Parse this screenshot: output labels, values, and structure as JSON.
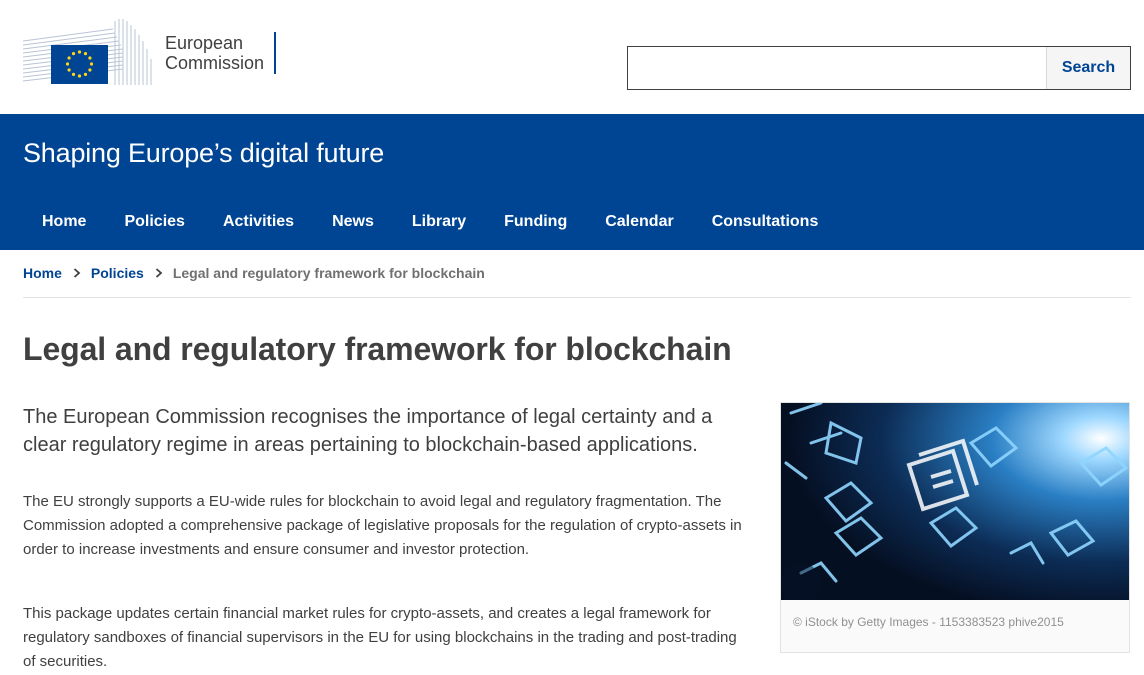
{
  "header": {
    "logo_line1": "European",
    "logo_line2": "Commission",
    "search_placeholder": "",
    "search_label": "Search"
  },
  "site": {
    "name": "Shaping Europe’s digital future"
  },
  "nav": {
    "items": [
      {
        "label": "Home"
      },
      {
        "label": "Policies"
      },
      {
        "label": "Activities"
      },
      {
        "label": "News"
      },
      {
        "label": "Library"
      },
      {
        "label": "Funding"
      },
      {
        "label": "Calendar"
      },
      {
        "label": "Consultations"
      }
    ]
  },
  "breadcrumb": {
    "items": [
      {
        "label": "Home"
      },
      {
        "label": "Policies"
      }
    ],
    "current": "Legal and regulatory framework for blockchain"
  },
  "page": {
    "title": "Legal and regulatory framework for blockchain",
    "lead": "The European Commission recognises the importance of legal certainty and a clear regulatory regime in areas pertaining to blockchain-based applications.",
    "paragraphs": [
      "The EU strongly supports a EU-wide rules for blockchain to avoid legal and regulatory fragmentation. The Commission adopted a comprehensive package of legislative proposals for the regulation of crypto-assets in order to increase investments and ensure consumer and investor protection.",
      "This package updates certain financial market rules for crypto-assets, and creates a legal framework for regulatory sandboxes of financial supervisors in the EU for using blockchains in the trading and post-trading of securities."
    ],
    "image_caption": "© iStock by Getty Images - 1153383523 phive2015"
  },
  "colors": {
    "brand_blue": "#004494",
    "text": "#404040",
    "muted": "#707070"
  }
}
